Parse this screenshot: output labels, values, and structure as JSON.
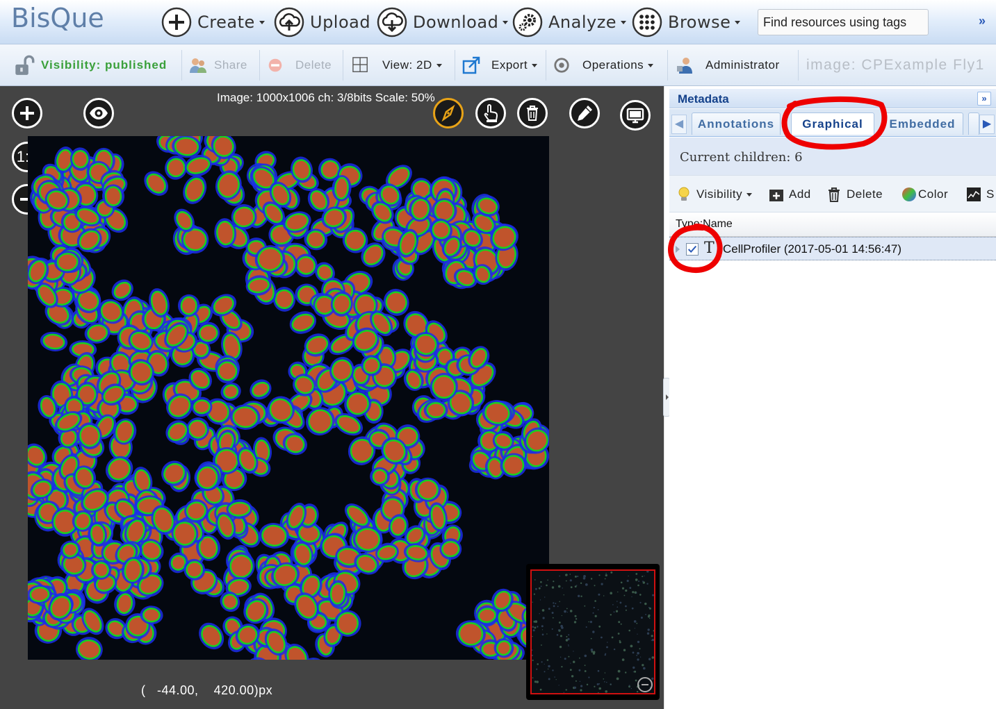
{
  "app": {
    "logo": "BisQue"
  },
  "top_menu": {
    "create": "Create",
    "upload": "Upload",
    "download": "Download",
    "analyze": "Analyze",
    "browse": "Browse",
    "search_placeholder": "Find resources using tags"
  },
  "toolbar": {
    "visibility": "Visibility: published",
    "share": "Share",
    "delete": "Delete",
    "view": "View: 2D",
    "export": "Export",
    "operations": "Operations",
    "user": "Administrator",
    "image_name": "image: CPExample Fly1"
  },
  "viewer": {
    "image_info": "Image: 1000x1006 ch: 3/8bits Scale: 50%",
    "zoom_reset_label": "1:1",
    "coords_x": "-44.00,",
    "coords_y": "420.00)px",
    "coords_open": "("
  },
  "panel": {
    "title": "Metadata",
    "tabs": [
      {
        "label": "Annotations",
        "active": false
      },
      {
        "label": "Graphical",
        "active": true
      },
      {
        "label": "Embedded",
        "active": false
      }
    ],
    "children_text": "Current children: 6",
    "ops": {
      "visibility": "Visibility",
      "add": "Add",
      "delete": "Delete",
      "color": "Color",
      "more": "S"
    },
    "grid": {
      "header": "Type:Name",
      "rows": [
        {
          "type": "T",
          "name": "CellProfiler (2017-05-01 14:56:47)",
          "checked": true
        }
      ]
    }
  },
  "colors": {
    "accent": "#15428b",
    "visibility_green": "#3aa03a",
    "annotation_red": "#ee0000",
    "cell_fill": "#c0542c",
    "cell_outline": "#18d020",
    "cell_halo": "#1b2ee8"
  }
}
